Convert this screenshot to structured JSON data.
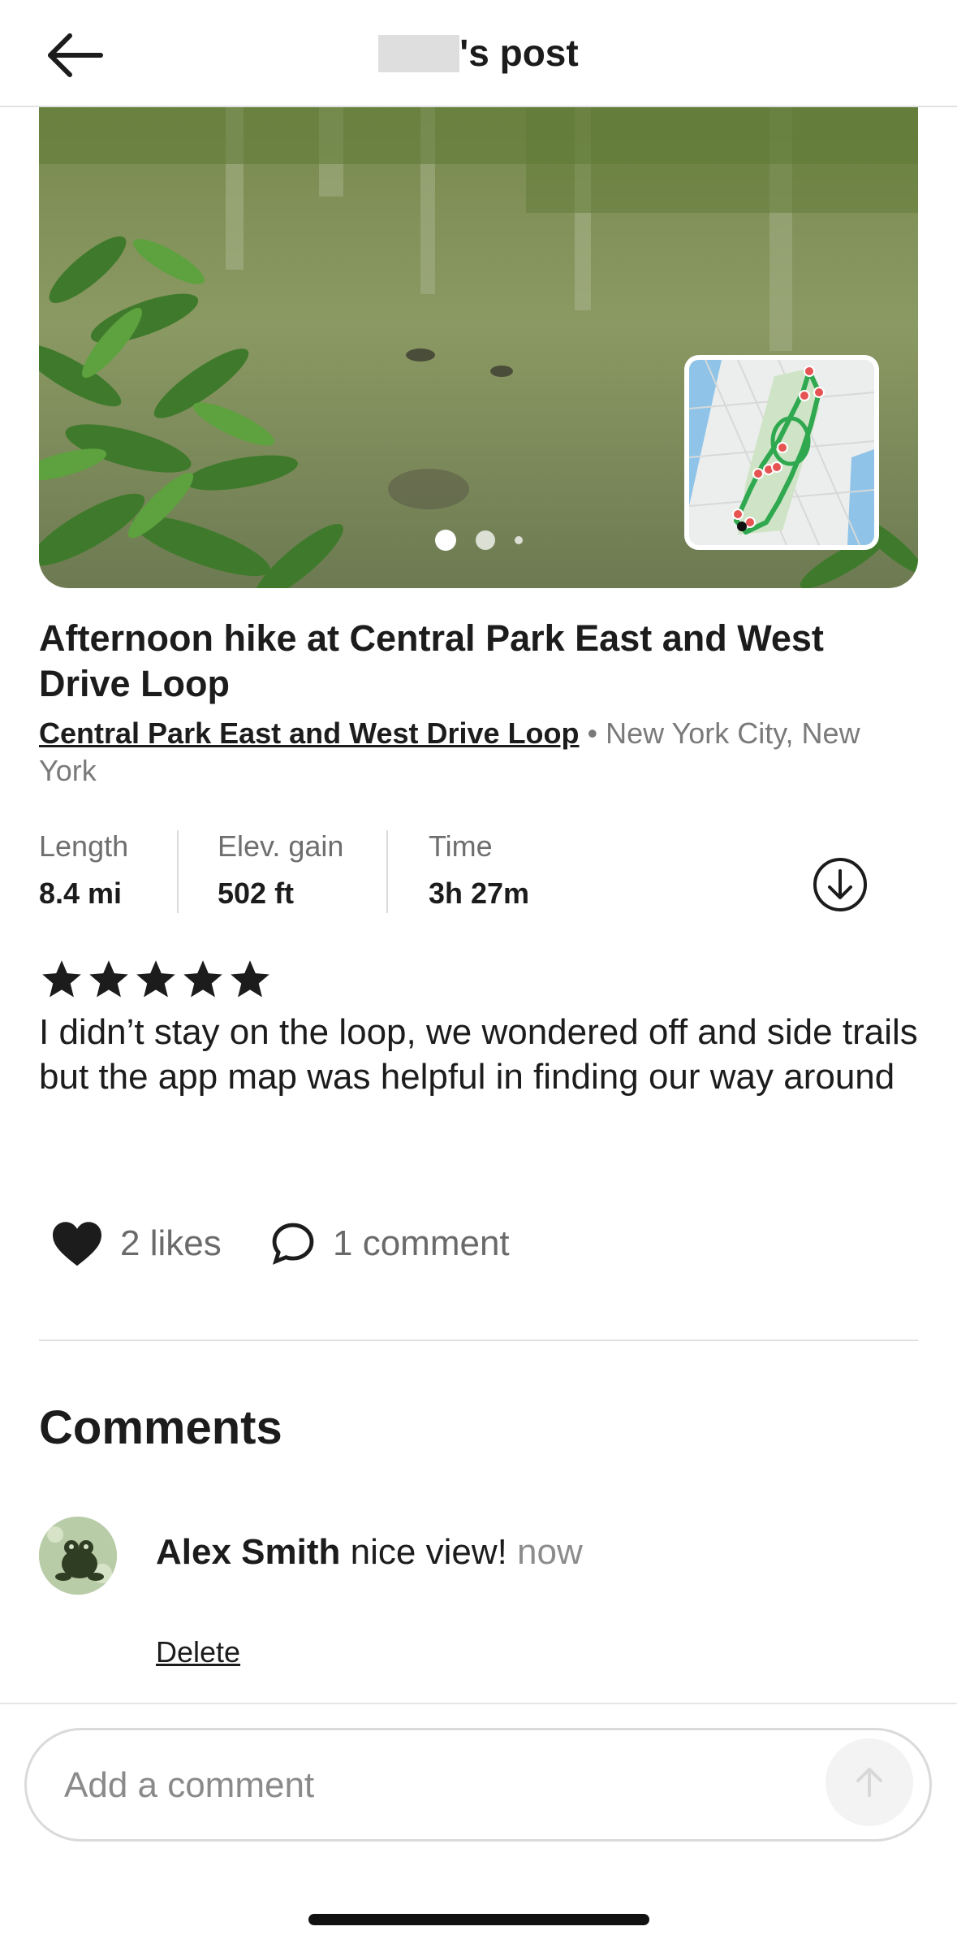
{
  "header": {
    "title_suffix": "'s post",
    "back_icon": "arrow-left-icon"
  },
  "photo": {
    "carousel_count": 3,
    "active_index": 0,
    "map_thumbnail_icon": "route-map-icon"
  },
  "post": {
    "title": "Afternoon hike at Central Park East and West Drive Loop",
    "trail_name": "Central Park East and West Drive Loop",
    "separator": " • ",
    "location": "New York City, New York"
  },
  "stats": [
    {
      "label": "Length",
      "value": "8.4 mi"
    },
    {
      "label": "Elev. gain",
      "value": "502 ft"
    },
    {
      "label": "Time",
      "value": "3h 27m"
    }
  ],
  "download_icon": "download-circle-icon",
  "rating": {
    "stars": 5,
    "max": 5
  },
  "review": "I didn’t stay on the loop, we wondered off and side trails but the app map was helpful in finding our way around",
  "engagement": {
    "likes_label": "2 likes",
    "comments_label": "1 comment",
    "like_icon": "heart-icon",
    "comment_icon": "speech-bubble-icon"
  },
  "comments": {
    "heading": "Comments",
    "items": [
      {
        "author": "Alex Smith",
        "text": "nice view!",
        "time": "now",
        "action": "Delete"
      }
    ]
  },
  "composer": {
    "placeholder": "Add a comment",
    "send_icon": "arrow-up-icon"
  },
  "colors": {
    "text": "#1c1c1c",
    "muted": "#7a7a7a",
    "route_green": "#2fa84f",
    "marker_red": "#e55353"
  }
}
